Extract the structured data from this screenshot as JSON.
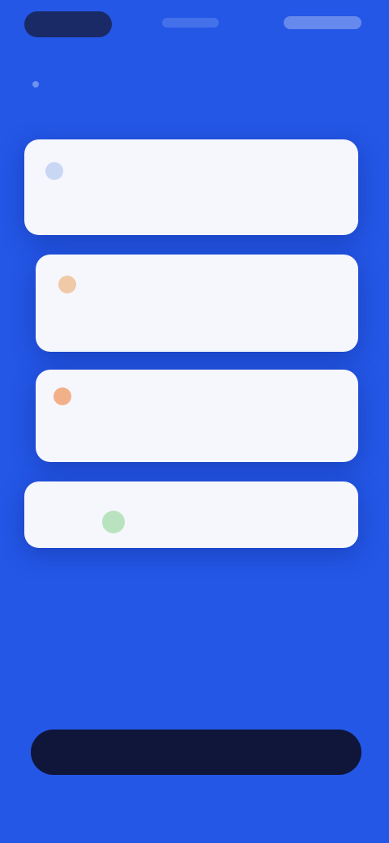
{
  "status_bar": {
    "time": "",
    "indicators": ""
  },
  "cards": [
    {
      "icon": "shield-icon",
      "title": "",
      "description": ""
    },
    {
      "icon": "clock-icon",
      "title": "",
      "description": ""
    },
    {
      "icon": "alert-icon",
      "title": "",
      "description": ""
    },
    {
      "icon": "check-icon",
      "title": "",
      "description": ""
    }
  ],
  "onboarding": {
    "headline": "",
    "subtext": ""
  },
  "cta": {
    "label": ""
  },
  "colors": {
    "background": "#2457e6",
    "card": "#f6f7fc",
    "button": "#10163a"
  }
}
